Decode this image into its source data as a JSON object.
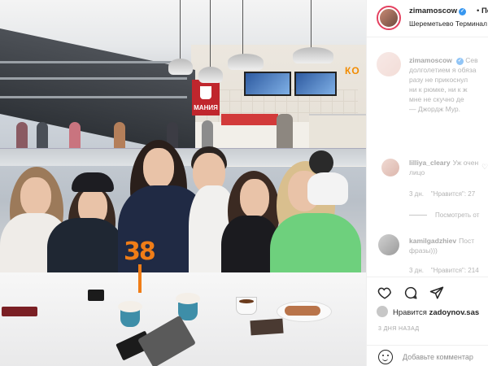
{
  "post": {
    "author": "zimamoscow",
    "follow_prefix": "•",
    "follow_label": "По",
    "location": "Шереметьево Терминал"
  },
  "caption": {
    "author": "zimamoscow",
    "lines": [
      "Сев",
      "долголетием я обяза",
      "разу не прикоснул",
      "ни к рюмке, ни к ж",
      "мне не скучно де",
      "— Джордж Мур."
    ]
  },
  "comments": [
    {
      "author": "lilliya_cleary",
      "text_lines": [
        "Уж очен",
        "лицо"
      ],
      "time": "3 дн.",
      "likes": "\"Нравится\": 27",
      "replies": "Посмотреть от"
    },
    {
      "author": "kamilgadzhiev",
      "text_lines": [
        "Пост",
        "фразы)))"
      ],
      "time": "3 дн.",
      "likes": "\"Нравится\": 214"
    }
  ],
  "actions": {
    "like_icon": "heart-icon",
    "comment_icon": "comment-icon",
    "share_icon": "share-icon"
  },
  "liked_by": {
    "prefix": "Нравится",
    "user": "zadoynov.sas"
  },
  "time_ago": "3 ДНЯ НАЗАД",
  "comment_input": {
    "placeholder": "Добавьте комментар"
  },
  "photo": {
    "sign_text": "МАНИЯ",
    "brand_text": "КО",
    "number_text": "38"
  },
  "colors": {
    "verified": "#3897f0",
    "story_ring": "#e4405f",
    "secondary_text": "#8e8e8e"
  }
}
